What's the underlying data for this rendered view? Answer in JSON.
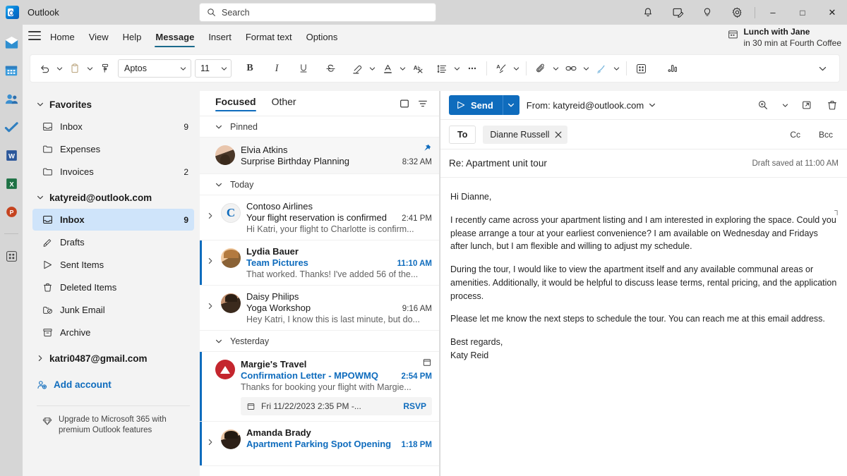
{
  "titlebar": {
    "app_name": "Outlook",
    "logo_icon": "outlook-logo-icon",
    "search_placeholder": "Search",
    "search_icon": "search-icon",
    "window_icons": [
      {
        "name": "notifications-bell-icon",
        "glyph": "bell"
      },
      {
        "name": "note-edit-icon",
        "glyph": "note"
      },
      {
        "name": "tips-lightbulb-icon",
        "glyph": "bulb"
      },
      {
        "name": "settings-gear-icon",
        "glyph": "gear"
      }
    ],
    "minimize_label": "–",
    "maximize_label": "□",
    "close_label": "✕"
  },
  "ribbon": {
    "menu_icon": "hamburger-menu-icon",
    "tabs": [
      {
        "label": "Home",
        "active": false
      },
      {
        "label": "View",
        "active": false
      },
      {
        "label": "Help",
        "active": false
      },
      {
        "label": "Message",
        "active": true
      },
      {
        "label": "Insert",
        "active": false
      },
      {
        "label": "Format text",
        "active": false
      },
      {
        "label": "Options",
        "active": false
      }
    ],
    "reminder": {
      "icon": "calendar-event-icon",
      "title": "Lunch with Jane",
      "subtitle": "in 30 min at Fourth Coffee"
    },
    "toolbar": {
      "font_name": "Aptos",
      "font_size": "11",
      "bold_label": "B",
      "italic_label": "I",
      "items": [
        {
          "name": "undo-icon"
        },
        {
          "name": "undo-chevron-icon"
        },
        {
          "name": "paste-clipboard-icon"
        },
        {
          "name": "paste-chevron-icon"
        },
        {
          "name": "format-painter-icon"
        },
        {
          "name": "font-name-select"
        },
        {
          "name": "font-size-select"
        },
        {
          "name": "bold-button"
        },
        {
          "name": "italic-button"
        },
        {
          "name": "underline-button"
        },
        {
          "name": "strikethrough-button"
        },
        {
          "name": "highlight-color-button"
        },
        {
          "name": "highlight-chevron-icon"
        },
        {
          "name": "font-color-button"
        },
        {
          "name": "font-color-chevron-icon"
        },
        {
          "name": "clear-formatting-button"
        },
        {
          "name": "paragraph-spacing-button"
        },
        {
          "name": "paragraph-chevron-icon"
        },
        {
          "name": "more-formatting-icon"
        },
        {
          "name": "signature-button"
        },
        {
          "name": "signature-chevron-icon"
        },
        {
          "name": "attach-file-button"
        },
        {
          "name": "attach-chevron-icon"
        },
        {
          "name": "insert-link-button"
        },
        {
          "name": "link-chevron-icon"
        },
        {
          "name": "ink-draw-button"
        },
        {
          "name": "ink-chevron-icon"
        },
        {
          "name": "apps-button"
        },
        {
          "name": "poll-chart-button"
        }
      ],
      "expand_icon": "ribbon-expand-chevron-icon"
    }
  },
  "rail": {
    "items": [
      {
        "name": "rail-mail-icon",
        "label": "Mail"
      },
      {
        "name": "rail-calendar-icon",
        "label": "Calendar"
      },
      {
        "name": "rail-people-icon",
        "label": "People"
      },
      {
        "name": "rail-todo-icon",
        "label": "To Do"
      },
      {
        "name": "rail-word-icon",
        "label": "Word",
        "badge": "W"
      },
      {
        "name": "rail-excel-icon",
        "label": "Excel",
        "badge": "X"
      },
      {
        "name": "rail-powerpoint-icon",
        "label": "PowerPoint",
        "badge": "P"
      },
      {
        "name": "rail-more-apps-icon",
        "label": "More apps"
      }
    ]
  },
  "folders": {
    "favorites_label": "Favorites",
    "favorites": [
      {
        "label": "Inbox",
        "count": "9",
        "icon": "inbox-icon"
      },
      {
        "label": "Expenses",
        "count": "",
        "icon": "folder-icon"
      },
      {
        "label": "Invoices",
        "count": "2",
        "icon": "folder-icon"
      }
    ],
    "account_label": "katyreid@outlook.com",
    "account_folders": [
      {
        "label": "Inbox",
        "count": "9",
        "icon": "inbox-icon",
        "selected": true
      },
      {
        "label": "Drafts",
        "count": "",
        "icon": "drafts-pencil-icon",
        "selected": false
      },
      {
        "label": "Sent Items",
        "count": "",
        "icon": "sent-arrow-icon",
        "selected": false
      },
      {
        "label": "Deleted Items",
        "count": "",
        "icon": "trash-icon",
        "selected": false
      },
      {
        "label": "Junk Email",
        "count": "",
        "icon": "junk-block-icon",
        "selected": false
      },
      {
        "label": "Archive",
        "count": "",
        "icon": "archive-box-icon",
        "selected": false
      }
    ],
    "second_account_label": "katri0487@gmail.com",
    "add_account_label": "Add account",
    "add_account_icon": "add-person-icon",
    "upgrade_icon": "diamond-icon",
    "upgrade_text": "Upgrade to Microsoft 365 with premium Outlook features"
  },
  "message_list": {
    "pivots": [
      {
        "label": "Focused",
        "active": true
      },
      {
        "label": "Other",
        "active": false
      }
    ],
    "header_icons": [
      {
        "name": "reading-pane-toggle-icon"
      },
      {
        "name": "filter-icon"
      }
    ],
    "sections": [
      {
        "label": "Pinned",
        "messages": [
          {
            "sender": "Elvia Atkins",
            "subject": "Surprise Birthday Planning",
            "preview": "",
            "time": "8:32 AM",
            "unread": false,
            "pinned": true,
            "pin_icon": "pin-icon",
            "avatar": "av-a",
            "has_chevron": false
          }
        ]
      },
      {
        "label": "Today",
        "messages": [
          {
            "sender": "Contoso Airlines",
            "subject": "Your flight reservation is confirmed",
            "preview": "Hi Katri, your flight to Charlotte is confirm...",
            "time": "2:41 PM",
            "unread": false,
            "pinned": false,
            "avatar": "av-b",
            "avatar_letter": "C",
            "has_chevron": true
          },
          {
            "sender": "Lydia Bauer",
            "subject": "Team Pictures",
            "preview": "That worked. Thanks! I've added 56 of the...",
            "time": "11:10 AM",
            "unread": true,
            "pinned": false,
            "avatar": "av-c",
            "has_chevron": true
          },
          {
            "sender": "Daisy Philips",
            "subject": "Yoga Workshop",
            "preview": "Hey Katri, I know this is last minute, but do...",
            "time": "9:16 AM",
            "unread": false,
            "pinned": false,
            "avatar": "av-d",
            "has_chevron": true
          }
        ]
      },
      {
        "label": "Yesterday",
        "messages": [
          {
            "sender": "Margie's Travel",
            "subject": "Confirmation Letter - MPOWMQ",
            "preview": "Thanks for booking your flight with Margie...",
            "time": "2:54 PM",
            "unread": true,
            "pinned": false,
            "avatar": "av-e",
            "has_chevron": false,
            "calendar_icon": "calendar-icon",
            "event": {
              "icon": "calendar-icon",
              "text": "Fri 11/22/2023 2:35 PM -...",
              "action": "RSVP"
            }
          },
          {
            "sender": "Amanda Brady",
            "subject": "Apartment Parking Spot Opening",
            "preview": "",
            "time": "1:18 PM",
            "unread": true,
            "pinned": false,
            "avatar": "av-f",
            "has_chevron": true
          }
        ]
      }
    ]
  },
  "compose": {
    "send_label": "Send",
    "send_icon": "send-arrow-icon",
    "send_chevron_icon": "send-options-chevron-icon",
    "from_label": "From: katyreid@outlook.com",
    "from_chevron_icon": "from-chevron-icon",
    "top_icons": [
      {
        "name": "zoom-icon"
      },
      {
        "name": "zoom-chevron-icon"
      },
      {
        "name": "pop-out-icon"
      },
      {
        "name": "discard-draft-icon"
      }
    ],
    "to_label": "To",
    "recipients": [
      {
        "name": "Dianne Russell",
        "remove_icon": "remove-recipient-icon"
      }
    ],
    "cc_label": "Cc",
    "bcc_label": "Bcc",
    "subject": "Re: Apartment unit tour",
    "draft_status": "Draft saved at 11:00 AM",
    "wrap_marker": "┐",
    "body": [
      "Hi Dianne,",
      "I recently came across your apartment listing and I am interested in exploring the space. Could you please arrange a tour at your earliest convenience? I am available on Wednesday and Fridays after lunch, but I am flexible and willing to adjust my schedule.",
      "During the tour, I would like to view the apartment itself and any available communal areas or amenities. Additionally, it would be helpful to discuss lease terms, rental pricing, and the application process.",
      "Please let me know the next steps to schedule the tour. You can reach me at this email address.",
      "Best regards,",
      "Katy Reid"
    ]
  },
  "colors": {
    "accent": "#0f6cbd",
    "selection": "#cfe4fa",
    "window_chrome": "#d6d6d6",
    "pane_bg": "#f3f3f3",
    "tab_underline": "#1b6a8c"
  }
}
